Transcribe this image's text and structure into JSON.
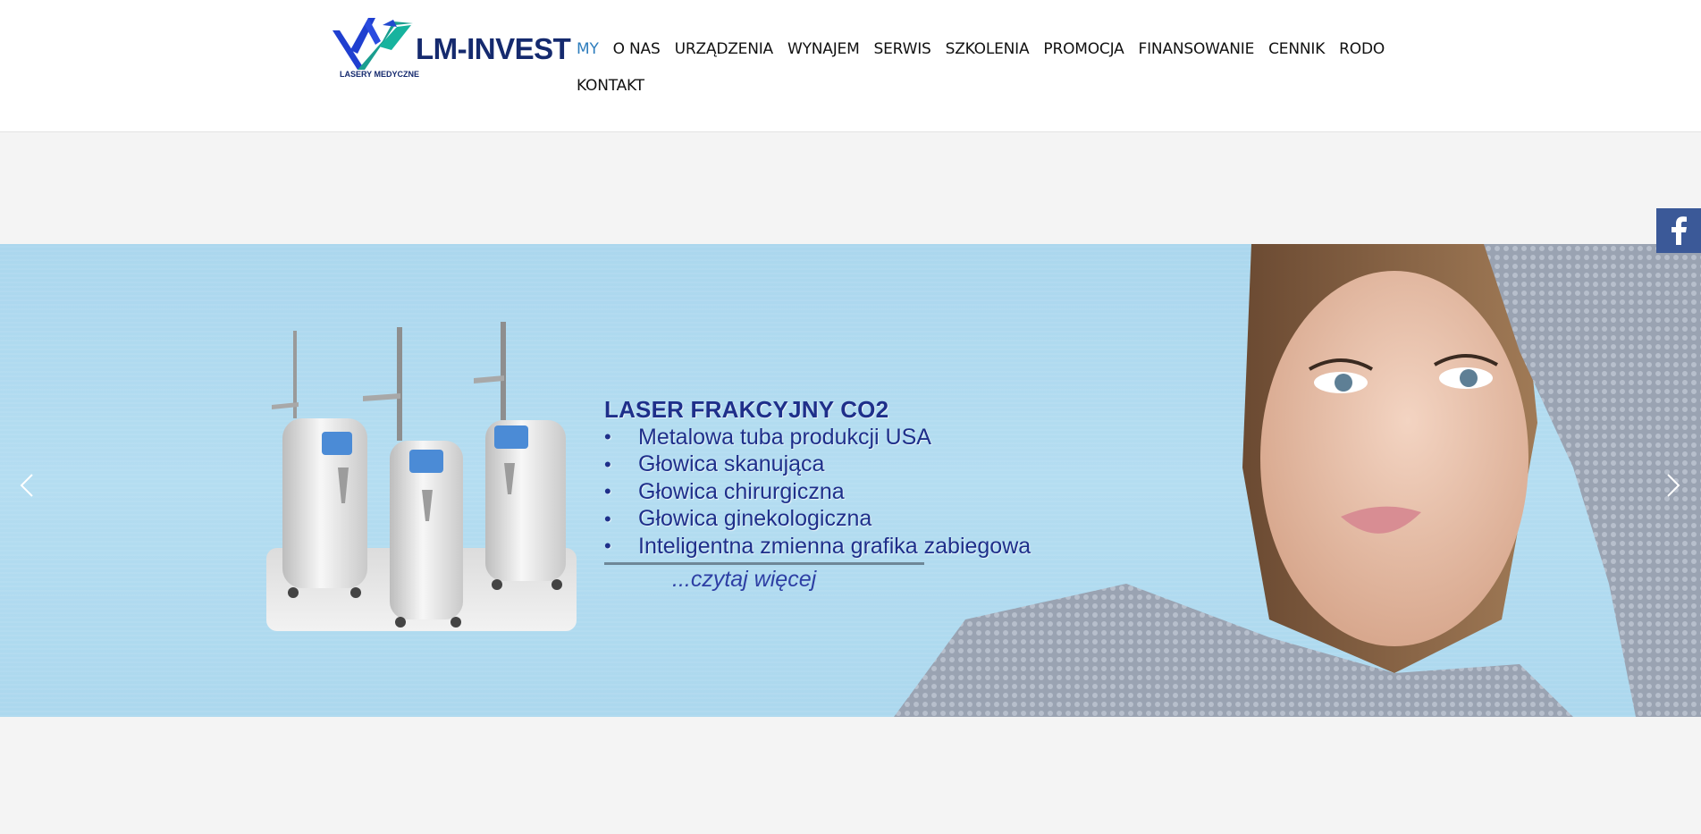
{
  "brand": {
    "name": "LM-INVEST",
    "tagline": "LASERY MEDYCZNE",
    "colors": {
      "navy": "#152a6e",
      "blue": "#1f3fd0",
      "teal": "#1a9e8f"
    }
  },
  "nav": {
    "items": [
      {
        "label": "MY",
        "active": true
      },
      {
        "label": "O NAS"
      },
      {
        "label": "URZĄDZENIA"
      },
      {
        "label": "WYNAJEM"
      },
      {
        "label": "SERWIS"
      },
      {
        "label": "SZKOLENIA"
      },
      {
        "label": "PROMOCJA"
      },
      {
        "label": "FINANSOWANIE"
      },
      {
        "label": "CENNIK"
      },
      {
        "label": "RODO"
      },
      {
        "label": "KONTAKT"
      }
    ],
    "active_color": "#2e7dbd"
  },
  "slide": {
    "title": "LASER FRAKCYJNY CO2",
    "bullets": [
      "Metalowa tuba produkcji USA",
      "Głowica skanująca",
      "Głowica chirurgiczna",
      "Głowica ginekologiczna",
      "Inteligentna zmienna grafika zabiegowa"
    ],
    "read_more": "...czytaj więcej",
    "bullet_char": "•",
    "background": "#b0dbf0"
  },
  "icons": {
    "prev": "chevron-left-icon",
    "next": "chevron-right-icon",
    "social": "facebook-icon"
  }
}
